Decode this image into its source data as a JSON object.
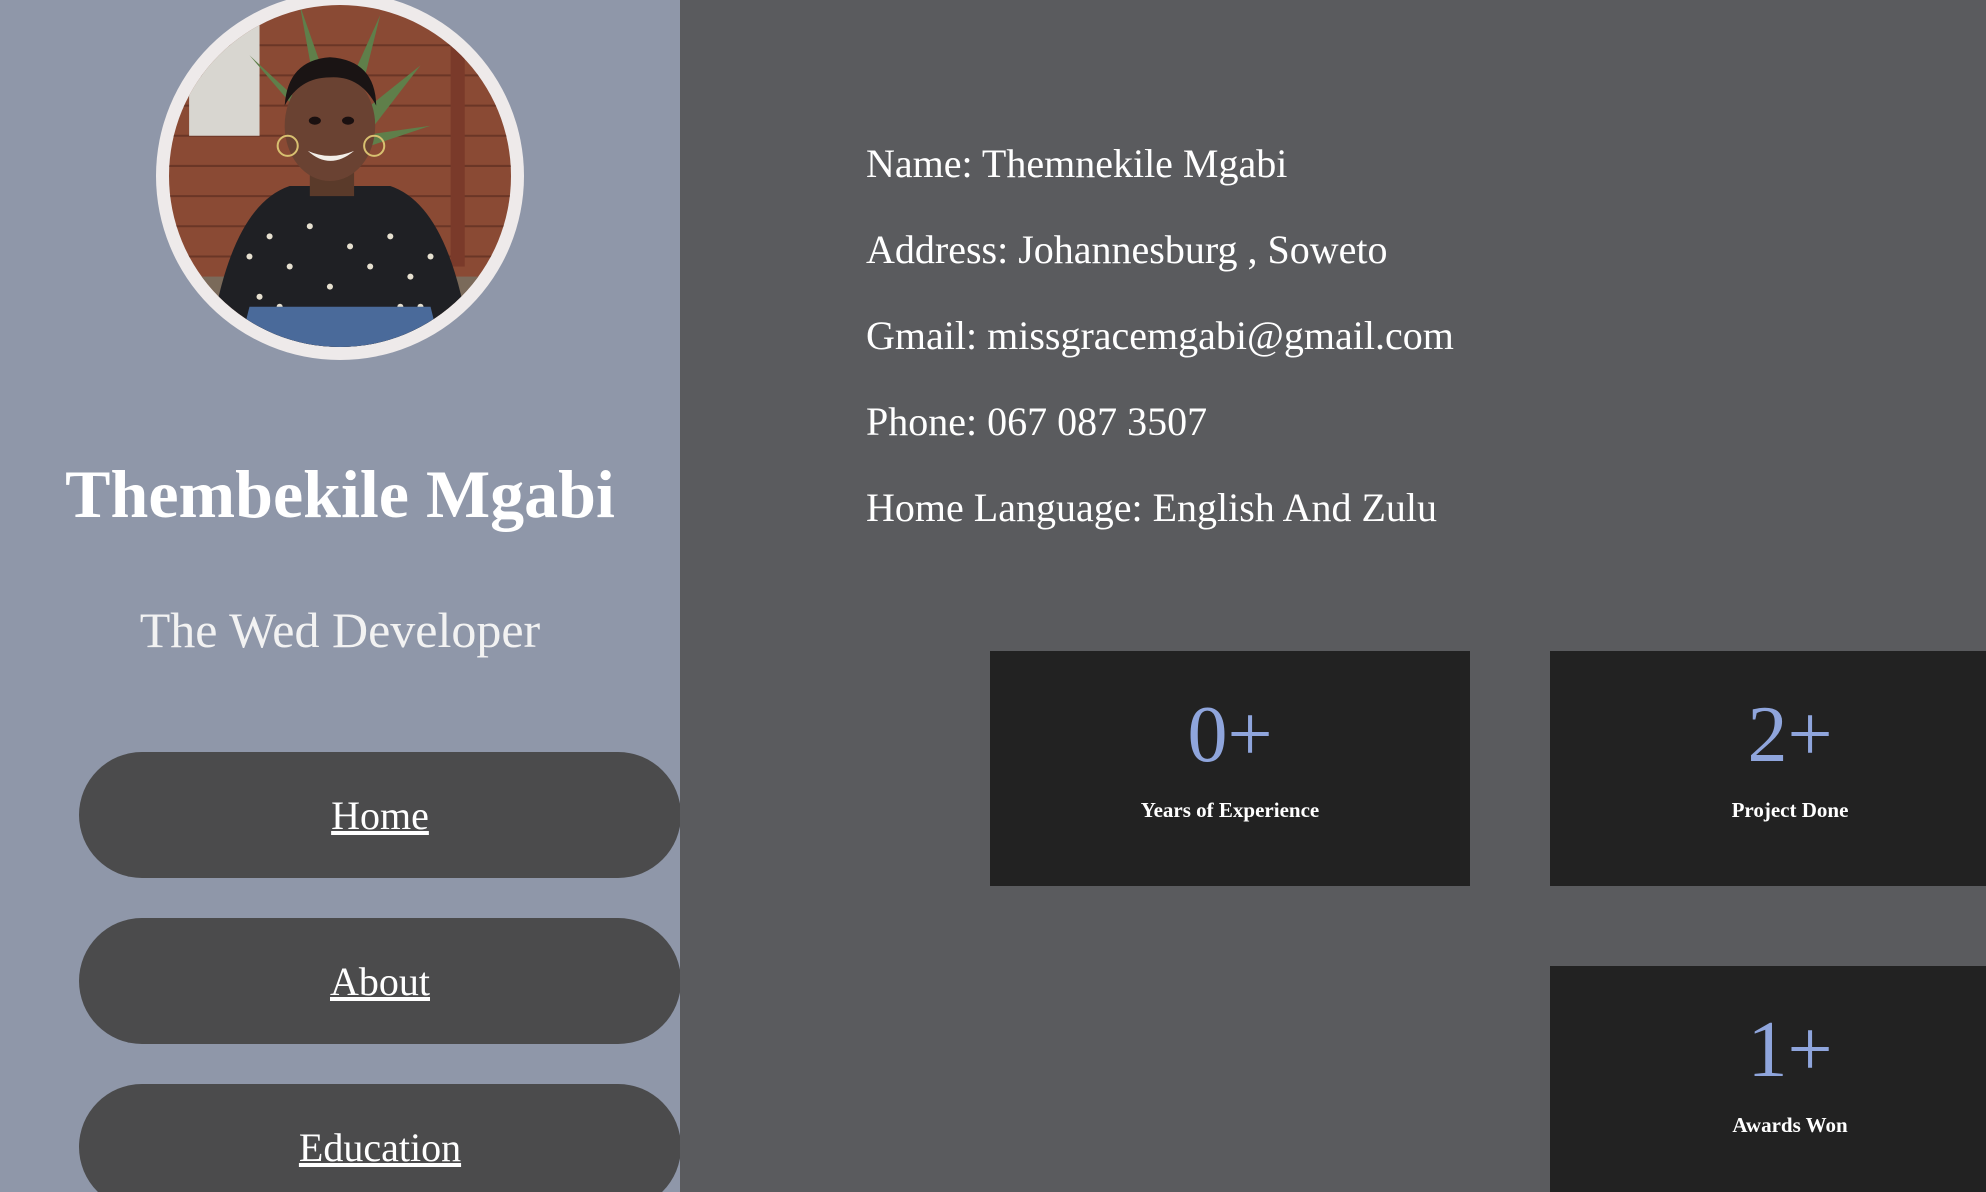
{
  "profile": {
    "name": "Thembekile Mgabi",
    "role": "The Wed Developer"
  },
  "nav": {
    "items": [
      {
        "label": "Home"
      },
      {
        "label": "About"
      },
      {
        "label": "Education"
      }
    ]
  },
  "info": {
    "name": "Name: Themnekile Mgabi",
    "address": "Address: Johannesburg , Soweto",
    "gmail": "Gmail: missgracemgabi@gmail.com",
    "phone": "Phone: 067 087 3507",
    "language": "Home Language: English And Zulu"
  },
  "stats": [
    {
      "value": "0+",
      "label": "Years of Experience"
    },
    {
      "value": "2+",
      "label": "Project Done"
    },
    {
      "value": "1+",
      "label": "Awards Won"
    }
  ],
  "colors": {
    "sidebar_bg": "#8f97a9",
    "main_bg": "#5a5b5e",
    "button_bg": "#4b4b4c",
    "card_bg": "#222222",
    "accent": "#8fa5dc"
  }
}
